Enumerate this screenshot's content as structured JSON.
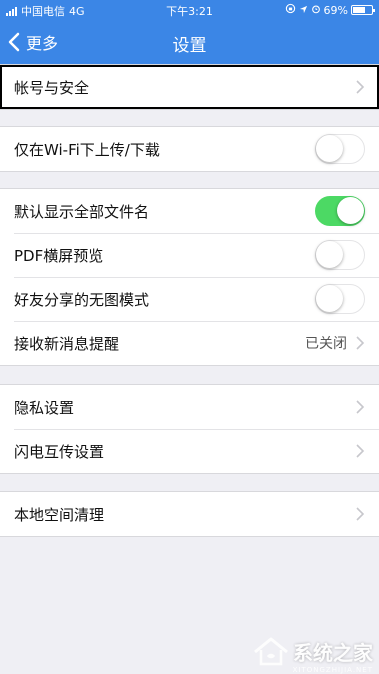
{
  "status_bar": {
    "carrier": "中国电信",
    "network": "4G",
    "time": "下午3:21",
    "battery": "69%",
    "battery_level": 0.69
  },
  "nav": {
    "back_label": "更多",
    "title": "设置"
  },
  "groups": [
    {
      "items": [
        {
          "label": "帐号与安全",
          "type": "link"
        }
      ]
    },
    {
      "items": [
        {
          "label": "仅在Wi-Fi下上传/下载",
          "type": "toggle",
          "state": false
        }
      ]
    },
    {
      "items": [
        {
          "label": "默认显示全部文件名",
          "type": "toggle",
          "state": true
        },
        {
          "label": "PDF横屏预览",
          "type": "toggle",
          "state": false
        },
        {
          "label": "好友分享的无图模式",
          "type": "toggle",
          "state": false
        },
        {
          "label": "接收新消息提醒",
          "type": "link",
          "value": "已关闭"
        }
      ]
    },
    {
      "items": [
        {
          "label": "隐私设置",
          "type": "link"
        },
        {
          "label": "闪电互传设置",
          "type": "link"
        }
      ]
    },
    {
      "items": [
        {
          "label": "本地空间清理",
          "type": "link"
        }
      ]
    }
  ],
  "colors": {
    "header": "#3b86e6",
    "toggle_on": "#4cd964",
    "background": "#efeff4"
  },
  "watermark": {
    "text": "系统之家",
    "sub": "XITONGZHIJIA.NET"
  }
}
